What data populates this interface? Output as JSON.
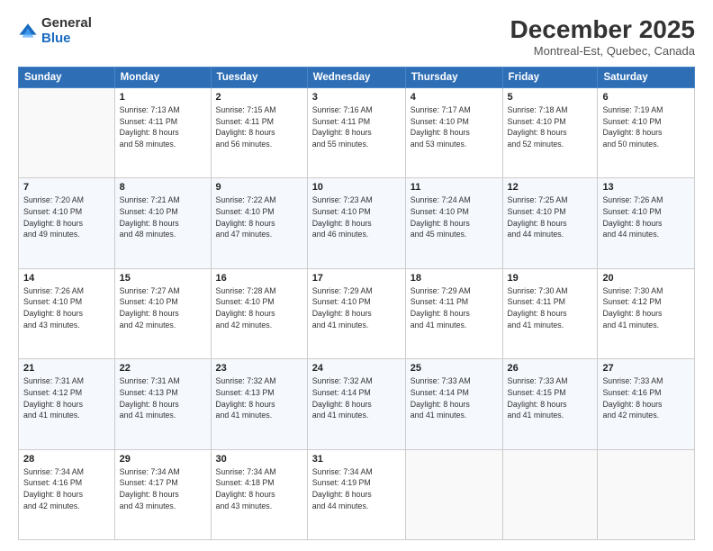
{
  "header": {
    "logo": {
      "line1": "General",
      "line2": "Blue"
    },
    "title": "December 2025",
    "location": "Montreal-Est, Quebec, Canada"
  },
  "days_of_week": [
    "Sunday",
    "Monday",
    "Tuesday",
    "Wednesday",
    "Thursday",
    "Friday",
    "Saturday"
  ],
  "weeks": [
    [
      {
        "day": "",
        "info": ""
      },
      {
        "day": "1",
        "info": "Sunrise: 7:13 AM\nSunset: 4:11 PM\nDaylight: 8 hours\nand 58 minutes."
      },
      {
        "day": "2",
        "info": "Sunrise: 7:15 AM\nSunset: 4:11 PM\nDaylight: 8 hours\nand 56 minutes."
      },
      {
        "day": "3",
        "info": "Sunrise: 7:16 AM\nSunset: 4:11 PM\nDaylight: 8 hours\nand 55 minutes."
      },
      {
        "day": "4",
        "info": "Sunrise: 7:17 AM\nSunset: 4:10 PM\nDaylight: 8 hours\nand 53 minutes."
      },
      {
        "day": "5",
        "info": "Sunrise: 7:18 AM\nSunset: 4:10 PM\nDaylight: 8 hours\nand 52 minutes."
      },
      {
        "day": "6",
        "info": "Sunrise: 7:19 AM\nSunset: 4:10 PM\nDaylight: 8 hours\nand 50 minutes."
      }
    ],
    [
      {
        "day": "7",
        "info": "Sunrise: 7:20 AM\nSunset: 4:10 PM\nDaylight: 8 hours\nand 49 minutes."
      },
      {
        "day": "8",
        "info": "Sunrise: 7:21 AM\nSunset: 4:10 PM\nDaylight: 8 hours\nand 48 minutes."
      },
      {
        "day": "9",
        "info": "Sunrise: 7:22 AM\nSunset: 4:10 PM\nDaylight: 8 hours\nand 47 minutes."
      },
      {
        "day": "10",
        "info": "Sunrise: 7:23 AM\nSunset: 4:10 PM\nDaylight: 8 hours\nand 46 minutes."
      },
      {
        "day": "11",
        "info": "Sunrise: 7:24 AM\nSunset: 4:10 PM\nDaylight: 8 hours\nand 45 minutes."
      },
      {
        "day": "12",
        "info": "Sunrise: 7:25 AM\nSunset: 4:10 PM\nDaylight: 8 hours\nand 44 minutes."
      },
      {
        "day": "13",
        "info": "Sunrise: 7:26 AM\nSunset: 4:10 PM\nDaylight: 8 hours\nand 44 minutes."
      }
    ],
    [
      {
        "day": "14",
        "info": "Sunrise: 7:26 AM\nSunset: 4:10 PM\nDaylight: 8 hours\nand 43 minutes."
      },
      {
        "day": "15",
        "info": "Sunrise: 7:27 AM\nSunset: 4:10 PM\nDaylight: 8 hours\nand 42 minutes."
      },
      {
        "day": "16",
        "info": "Sunrise: 7:28 AM\nSunset: 4:10 PM\nDaylight: 8 hours\nand 42 minutes."
      },
      {
        "day": "17",
        "info": "Sunrise: 7:29 AM\nSunset: 4:10 PM\nDaylight: 8 hours\nand 41 minutes."
      },
      {
        "day": "18",
        "info": "Sunrise: 7:29 AM\nSunset: 4:11 PM\nDaylight: 8 hours\nand 41 minutes."
      },
      {
        "day": "19",
        "info": "Sunrise: 7:30 AM\nSunset: 4:11 PM\nDaylight: 8 hours\nand 41 minutes."
      },
      {
        "day": "20",
        "info": "Sunrise: 7:30 AM\nSunset: 4:12 PM\nDaylight: 8 hours\nand 41 minutes."
      }
    ],
    [
      {
        "day": "21",
        "info": "Sunrise: 7:31 AM\nSunset: 4:12 PM\nDaylight: 8 hours\nand 41 minutes."
      },
      {
        "day": "22",
        "info": "Sunrise: 7:31 AM\nSunset: 4:13 PM\nDaylight: 8 hours\nand 41 minutes."
      },
      {
        "day": "23",
        "info": "Sunrise: 7:32 AM\nSunset: 4:13 PM\nDaylight: 8 hours\nand 41 minutes."
      },
      {
        "day": "24",
        "info": "Sunrise: 7:32 AM\nSunset: 4:14 PM\nDaylight: 8 hours\nand 41 minutes."
      },
      {
        "day": "25",
        "info": "Sunrise: 7:33 AM\nSunset: 4:14 PM\nDaylight: 8 hours\nand 41 minutes."
      },
      {
        "day": "26",
        "info": "Sunrise: 7:33 AM\nSunset: 4:15 PM\nDaylight: 8 hours\nand 41 minutes."
      },
      {
        "day": "27",
        "info": "Sunrise: 7:33 AM\nSunset: 4:16 PM\nDaylight: 8 hours\nand 42 minutes."
      }
    ],
    [
      {
        "day": "28",
        "info": "Sunrise: 7:34 AM\nSunset: 4:16 PM\nDaylight: 8 hours\nand 42 minutes."
      },
      {
        "day": "29",
        "info": "Sunrise: 7:34 AM\nSunset: 4:17 PM\nDaylight: 8 hours\nand 43 minutes."
      },
      {
        "day": "30",
        "info": "Sunrise: 7:34 AM\nSunset: 4:18 PM\nDaylight: 8 hours\nand 43 minutes."
      },
      {
        "day": "31",
        "info": "Sunrise: 7:34 AM\nSunset: 4:19 PM\nDaylight: 8 hours\nand 44 minutes."
      },
      {
        "day": "",
        "info": ""
      },
      {
        "day": "",
        "info": ""
      },
      {
        "day": "",
        "info": ""
      }
    ]
  ]
}
